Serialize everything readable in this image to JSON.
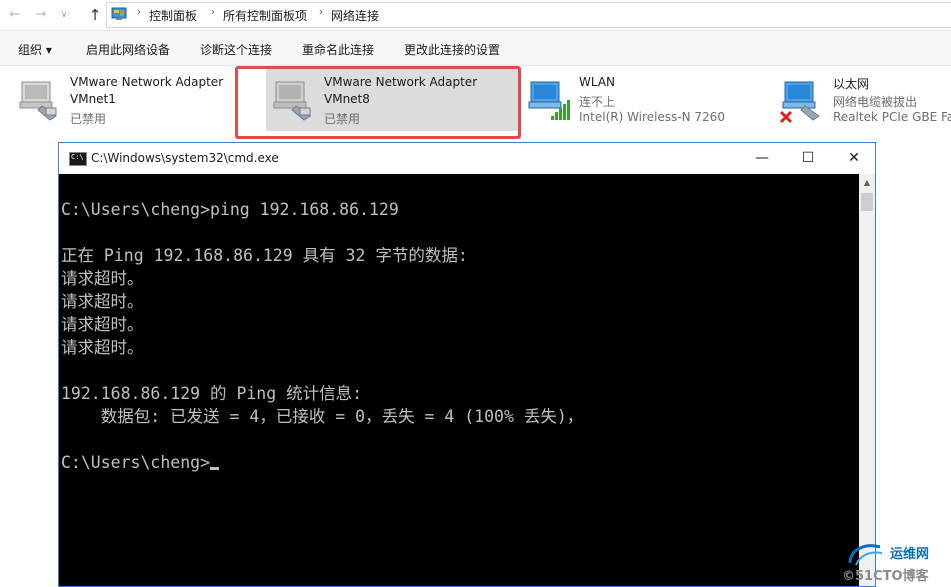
{
  "address_bar": {
    "breadcrumbs": [
      "控制面板",
      "所有控制面板项",
      "网络连接"
    ],
    "back_glyph": "←",
    "forward_glyph": "→",
    "recent_glyph": "∨",
    "up_glyph": "↑",
    "sep_glyph": "›"
  },
  "command_bar": {
    "organize": "组织 ▾",
    "enable": "启用此网络设备",
    "diagnose": "诊断这个连接",
    "rename": "重命名此连接",
    "change_settings": "更改此连接的设置"
  },
  "adapters": [
    {
      "name": "VMware Network Adapter",
      "line2": "VMnet1",
      "line3": "已禁用",
      "icon": "network-adapter-disabled-icon"
    },
    {
      "name": "VMware Network Adapter",
      "line2": "VMnet8",
      "line3": "已禁用",
      "icon": "network-adapter-disabled-icon"
    },
    {
      "name": "WLAN",
      "line2": "连不上",
      "line3": "Intel(R) Wireless-N 7260",
      "icon": "wireless-adapter-icon"
    },
    {
      "name": "以太网",
      "line2": "网络电缆被拔出",
      "line3": "Realtek PCIe GBE Fa",
      "icon": "ethernet-adapter-unplugged-icon"
    }
  ],
  "cmd_window": {
    "title": "C:\\Windows\\system32\\cmd.exe",
    "icon_text": "C:\\",
    "min_glyph": "—",
    "max_glyph": "☐",
    "close_glyph": "✕",
    "console_text": "C:\\Users\\cheng>ping 192.168.86.129\n\n正在 Ping 192.168.86.129 具有 32 字节的数据:\n请求超时。\n请求超时。\n请求超时。\n请求超时。\n\n192.168.86.129 的 Ping 统计信息:\n    数据包: 已发送 = 4，已接收 = 0，丢失 = 4 (100% 丢失)，\n\nC:\\Users\\cheng>"
  },
  "watermark": {
    "line1": "运维网",
    "line2": "©51CTO博客"
  },
  "colors": {
    "highlight": "#e34b4b",
    "console_bg": "#000000",
    "console_fg": "#c0c0c0",
    "window_border": "#3a7fd5"
  }
}
